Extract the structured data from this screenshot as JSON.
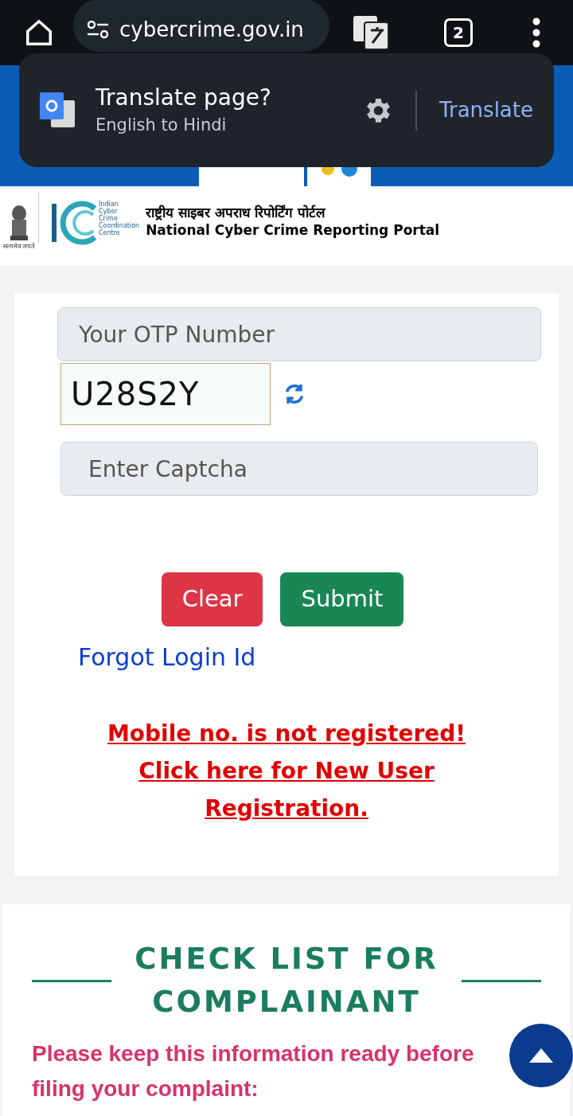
{
  "browser": {
    "url": "cybercrime.gov.in",
    "tab_count": "2"
  },
  "translate_popup": {
    "title": "Translate page?",
    "subtitle": "English to Hindi",
    "action": "Translate"
  },
  "header": {
    "emblem_motto": "सत्यमेव जयते",
    "logo_lines": [
      "Indian",
      "Cyber",
      "Crime",
      "Coordination",
      "Centre"
    ],
    "title_hindi": "राष्ट्रीय साइबर अपराध रिपोर्टिंग पोर्टल",
    "title_english": "National Cyber Crime Reporting Portal"
  },
  "form": {
    "otp": {
      "placeholder": "Your OTP Number"
    },
    "captcha_code": "U28S2Y",
    "captcha": {
      "placeholder": "Enter Captcha"
    },
    "buttons": [
      {
        "label": "Clear",
        "kind": "danger"
      },
      {
        "label": "Submit",
        "kind": "success"
      }
    ],
    "forgot_link": "Forgot Login Id",
    "error_lines": [
      "Mobile no. is not registered!",
      "Click here for New User",
      "Registration."
    ]
  },
  "checklist": {
    "title_lines": [
      "CHECK LIST FOR",
      "COMPLAINANT"
    ],
    "intro": "Please keep this information ready before filing your complaint:"
  }
}
